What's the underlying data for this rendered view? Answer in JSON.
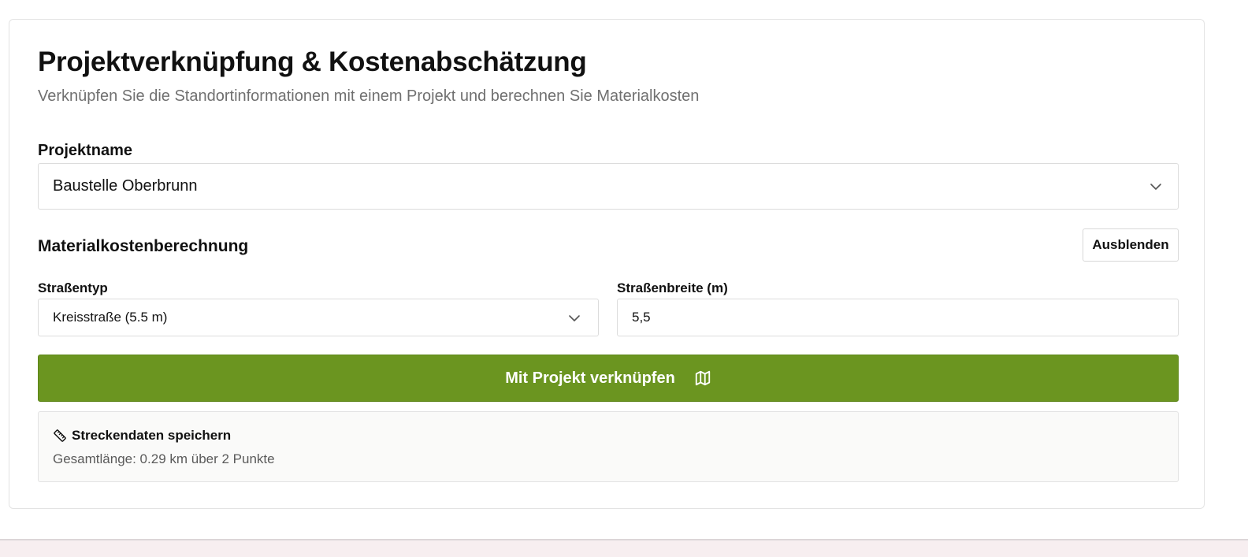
{
  "card": {
    "title": "Projektverknüpfung & Kostenabschätzung",
    "subtitle": "Verknüpfen Sie die Standortinformationen mit einem Projekt und berechnen Sie Materialkosten"
  },
  "project": {
    "label": "Projektname",
    "selected": "Baustelle Oberbrunn"
  },
  "material": {
    "section_title": "Materialkostenberechnung",
    "hide_label": "Ausblenden",
    "road_type_label": "Straßentyp",
    "road_type_selected": "Kreisstraße (5.5 m)",
    "road_width_label": "Straßenbreite (m)",
    "road_width_value": "5,5"
  },
  "actions": {
    "link_label": "Mit Projekt verknüpfen",
    "link_icon": "map-icon"
  },
  "route": {
    "heading": "Streckendaten speichern",
    "heading_icon": "ruler-icon",
    "summary": "Gesamtlänge: 0.29 km über 2 Punkte"
  },
  "colors": {
    "primary": "#6b9520",
    "muted_text": "#707070",
    "border": "#dcdcdc"
  }
}
